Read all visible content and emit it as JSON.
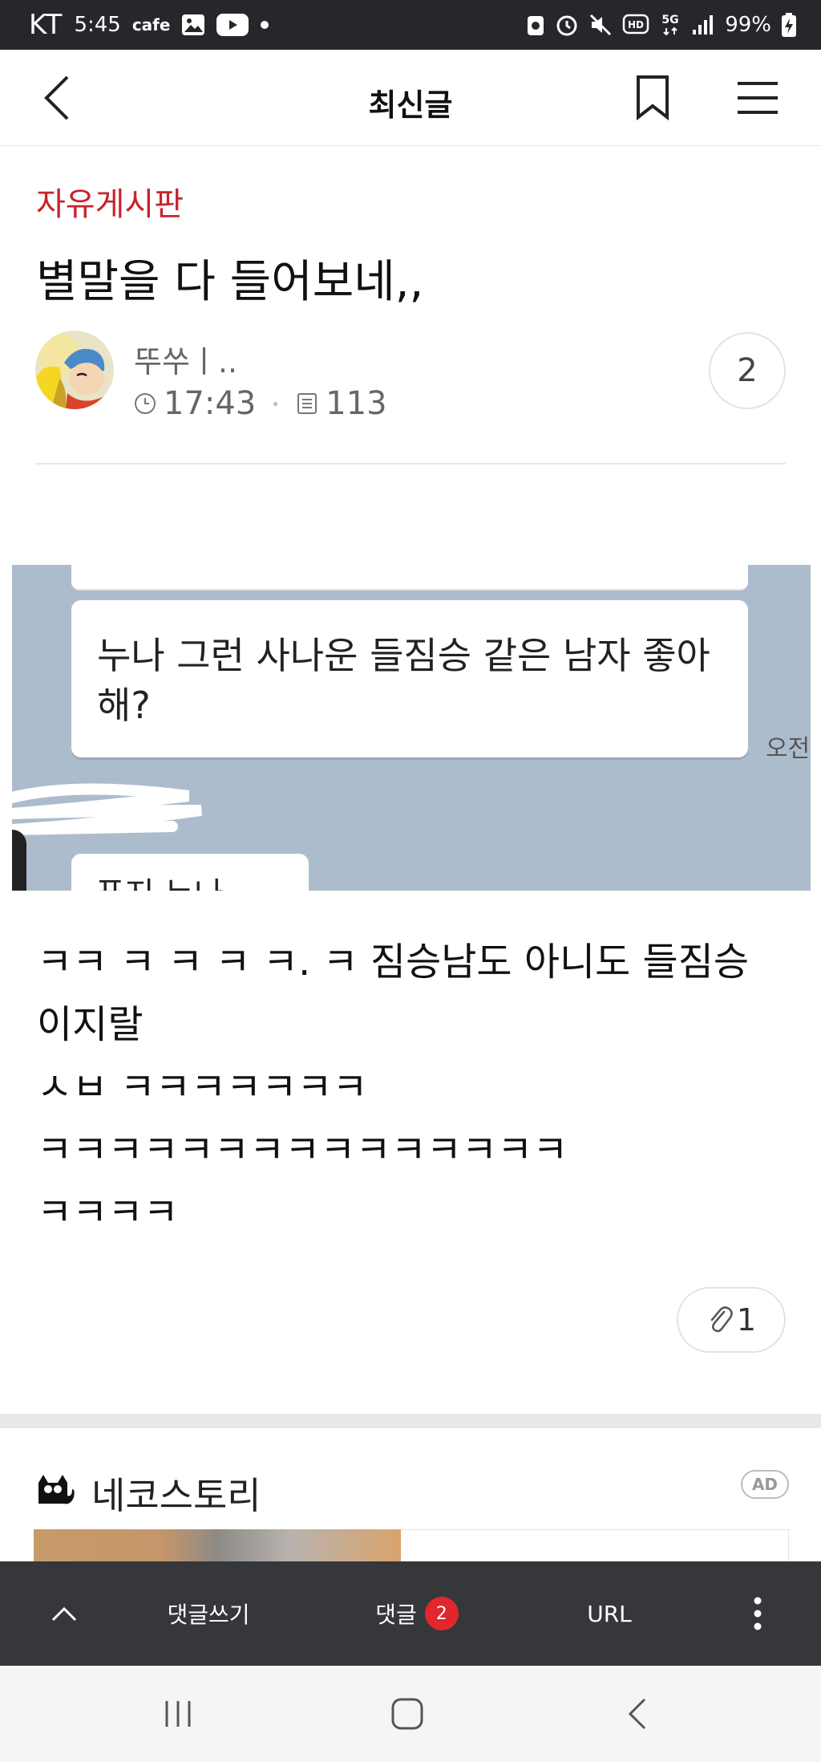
{
  "status_bar": {
    "carrier": "KT",
    "time": "5:45",
    "app_label": "cafe",
    "battery": "99%",
    "network": "5G",
    "hd_label": "HD"
  },
  "header": {
    "title": "최신글"
  },
  "post": {
    "board": "자유게시판",
    "title": "별말을 다 들어보네,,",
    "author": "뚜쑤ㅣ..",
    "time": "17:43",
    "views": "113",
    "comment_count": "2",
    "attachment_count": "1"
  },
  "image": {
    "chat_line1": "누나 그런 사나운 들짐승 같은 남자 좋아",
    "chat_line2": "해?",
    "time_label": "오전",
    "bottom_text": "푸지 누나"
  },
  "body_lines": [
    "ㅋㅋ ㅋ ㅋ ㅋ ㅋ. ㅋ 짐승남도 아니도 들짐승",
    "이지랄",
    "ㅅㅂ ㅋㅋㅋㅋㅋㅋㅋ",
    "ㅋㅋㅋㅋㅋㅋㅋㅋㅋㅋㅋㅋㅋㅋㅋ",
    "ㅋㅋㅋㅋ"
  ],
  "ad": {
    "name": "네코스토리",
    "badge": "AD"
  },
  "toolbar": {
    "write_label": "댓글쓰기",
    "comments_label": "댓글",
    "comments_badge": "2",
    "url_label": "URL"
  },
  "colors": {
    "board_red": "#c8232c",
    "status_bar": "#26272b",
    "toolbar": "#35373b",
    "badge_red": "#e0272d",
    "image_bg": "#adbccd"
  }
}
